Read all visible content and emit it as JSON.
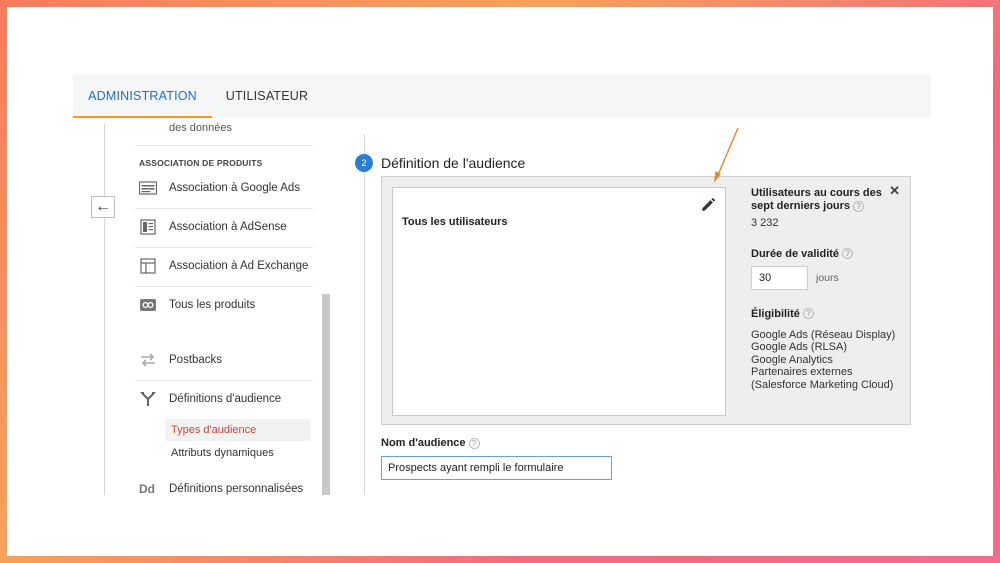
{
  "tabs": [
    {
      "label": "ADMINISTRATION",
      "active": true
    },
    {
      "label": "UTILISATEUR",
      "active": false
    }
  ],
  "sidebar": {
    "cut_item": "des données",
    "section_label": "ASSOCIATION DE PRODUITS",
    "items": [
      {
        "label": "Association à Google Ads",
        "icon": "google-ads-link-icon"
      },
      {
        "label": "Association à AdSense",
        "icon": "adsense-link-icon"
      },
      {
        "label": "Association à Ad Exchange",
        "icon": "ad-exchange-link-icon"
      },
      {
        "label": "Tous les produits",
        "icon": "all-products-icon"
      },
      {
        "label": "Postbacks",
        "icon": "postbacks-icon"
      },
      {
        "label": "Définitions d'audience",
        "icon": "audience-fork-icon"
      }
    ],
    "sub_items": [
      {
        "label": "Types d'audience",
        "active": true
      },
      {
        "label": "Attributs dynamiques",
        "active": false
      }
    ],
    "last_item": {
      "label": "Définitions personnalisées",
      "icon": "dd-icon",
      "icon_text": "Dd"
    }
  },
  "step": {
    "number": "2",
    "title": "Définition de l'audience"
  },
  "segment": {
    "title": "Tous les utilisateurs"
  },
  "info": {
    "users_heading": "Utilisateurs au cours des sept derniers jours",
    "users_value": "3 232",
    "validity_heading": "Durée de validité",
    "validity_value": "30",
    "validity_unit": "jours",
    "eligibility_heading": "Éligibilité",
    "eligibility_lines": [
      "Google Ads (Réseau Display)",
      "Google Ads (RLSA)",
      "Google Analytics",
      "Partenaires externes",
      "(Salesforce Marketing Cloud)"
    ],
    "help": "?",
    "close": "✕"
  },
  "audience_name": {
    "label": "Nom d'audience",
    "value": "Prospects ayant rempli le formulaire"
  },
  "colors": {
    "accent_blue": "#1f6fc4",
    "tab_underline": "#f39a1d",
    "active_red": "#d2443c",
    "arrow": "#e08a3a"
  }
}
